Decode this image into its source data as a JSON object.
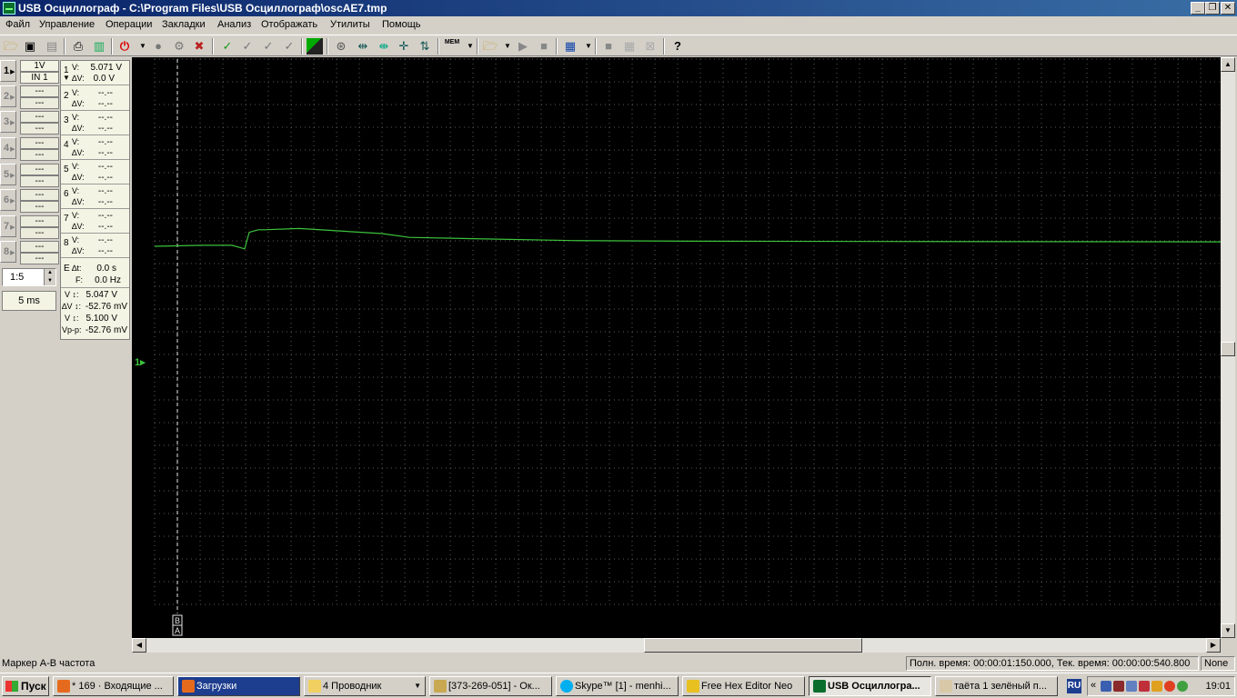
{
  "window": {
    "title": "USB Осциллограф - C:\\Program Files\\USB Осциллограф\\oscAE7.tmp"
  },
  "menu": [
    "Файл",
    "Управление",
    "Операции",
    "Закладки",
    "Анализ",
    "Отображать",
    "Утилиты",
    "Помощь"
  ],
  "toolbar": {
    "icons": [
      "open-icon",
      "save-icon",
      "save-as-icon",
      "print-icon",
      "print-preview-icon",
      "power-icon",
      "record-icon",
      "run-icon",
      "stop-icon",
      "check-icon",
      "check-1-icon",
      "check-2-icon",
      "check-3-icon",
      "color-icon",
      "measure-icon",
      "cursor-icon",
      "cursor-2-icon",
      "cursor-3-icon",
      "cursor-4-icon",
      "memory-icon",
      "load-icon",
      "play-icon",
      "stop-2-icon",
      "abc-icon",
      "grid-1-icon",
      "grid-2-icon",
      "grid-3-icon",
      "help-icon"
    ],
    "mem_label": "MEM"
  },
  "channels": {
    "buttons": [
      "1",
      "2",
      "3",
      "4",
      "5",
      "6",
      "7",
      "8"
    ],
    "ch1_scale": "1V",
    "ch1_input": "IN 1",
    "empty": "---"
  },
  "info": {
    "ch1_v": "5.071 V",
    "ch1_dv": "0.0 V",
    "placeholder": "--.--",
    "v_label": "V:",
    "dv_label": "∆V:",
    "dt_label": "∆t:",
    "f_label": "F:",
    "e_label": "E",
    "dt": "0.0 s",
    "f": "0.0 Hz",
    "m1_label": "V ↕:",
    "m1": "5.047 V",
    "m2_label": "∆V ↕:",
    "m2": "-52.76 mV",
    "m3_label": "V ↕:",
    "m3": "5.100 V",
    "m4_label": "Vp-p:",
    "m4": "-52.76 mV"
  },
  "zoom": "1:5",
  "timebase": "5 ms",
  "scope": {
    "trace_color": "#3cc33c",
    "grid_color": "#5a5a5a",
    "marker_color": "#e6e6e6",
    "ch1_marker": "1▸",
    "marker_b": "B",
    "marker_a": "A"
  },
  "chart_data": {
    "type": "line",
    "series": [
      {
        "values_note": "",
        "x": [
          0.0,
          0.53,
          0.85,
          0.99,
          1.04,
          1.14,
          1.2,
          1.59,
          2.5,
          2.8,
          3.5,
          4.6,
          6.0,
          8.0,
          11.75
        ],
        "y": [
          5.05,
          5.058,
          5.058,
          5.03,
          5.16,
          5.18,
          5.18,
          5.19,
          5.15,
          5.12,
          5.11,
          5.095,
          5.09,
          5.088,
          5.085
        ]
      }
    ],
    "xlabel": "",
    "ylabel": "",
    "grid": true
  },
  "status": {
    "left": "Маркер А-В частота",
    "right": "Полн. время: 00:00:01:150.000, Тек. время: 00:00:00:540.800",
    "mode": "None"
  },
  "taskbar": {
    "start": "Пуск",
    "tasks": [
      "* 169 · Входящие ...",
      "Загрузки",
      "4 Проводник",
      "[373-269-051] - Ок...",
      "Skype™ [1] - menhi...",
      "Free Hex Editor Neo",
      "USB Осциллогра...",
      "таёта 1 зелёный п..."
    ],
    "lang": "RU",
    "clock": "19:01"
  }
}
